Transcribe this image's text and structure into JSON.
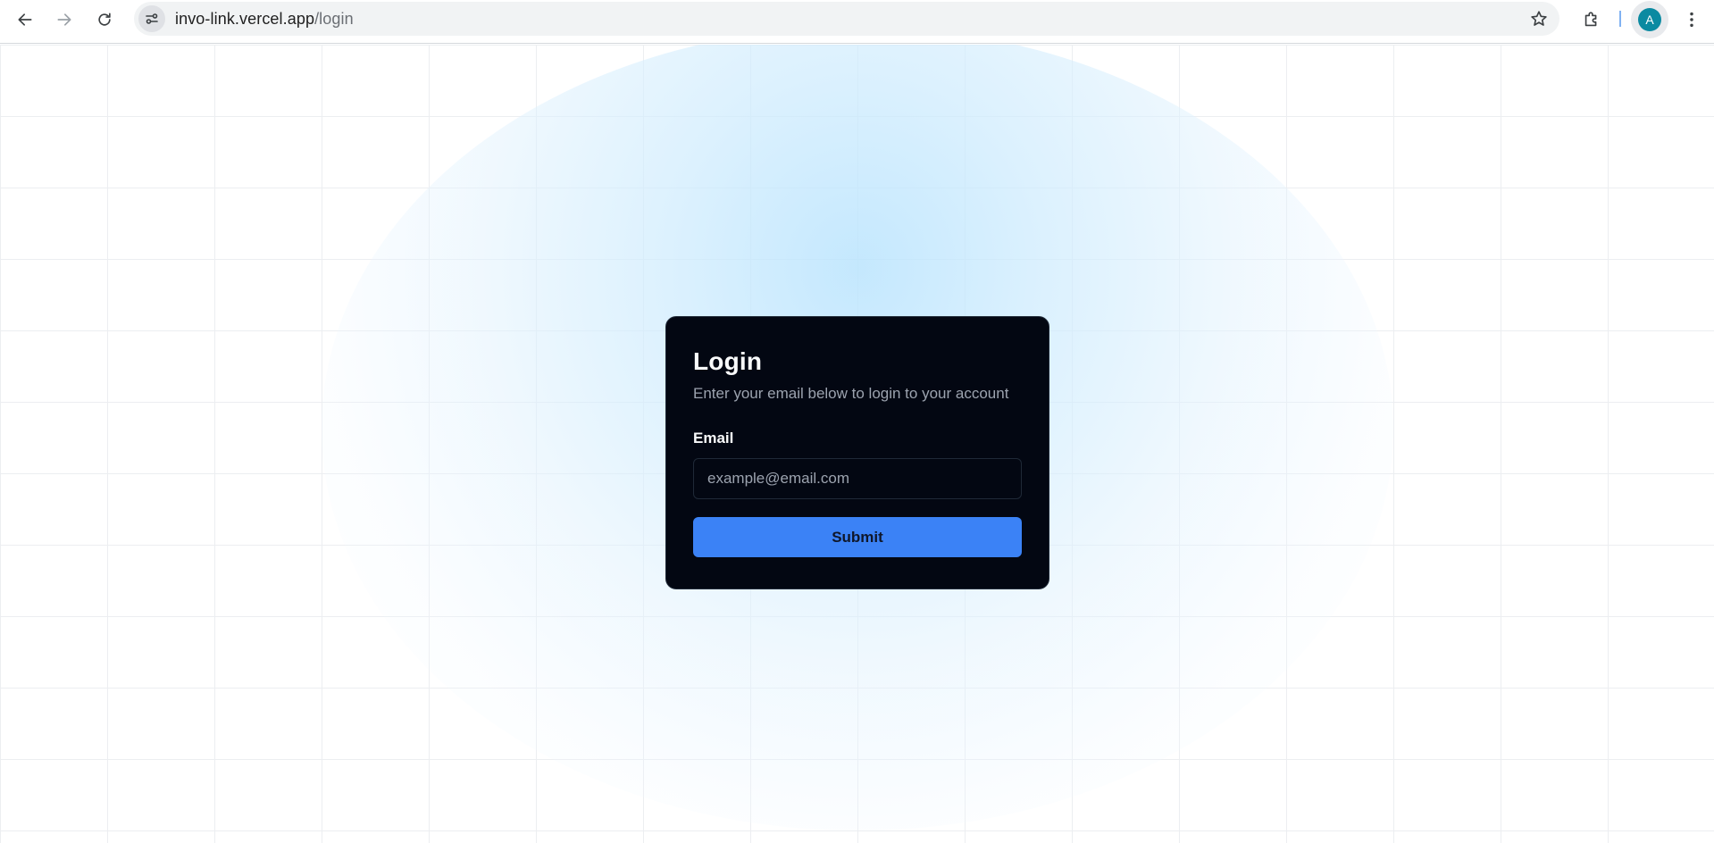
{
  "browser": {
    "url_host": "invo-link.vercel.app",
    "url_path": "/login",
    "profile_initial": "A",
    "icons": {
      "back": "back-arrow-icon",
      "forward": "forward-arrow-icon",
      "reload": "reload-icon",
      "site_info": "tune-icon",
      "bookmark": "star-icon",
      "extensions": "puzzle-icon",
      "menu": "kebab-menu-icon"
    },
    "colors": {
      "avatar": "#0b8aa1"
    }
  },
  "login": {
    "title": "Login",
    "description": "Enter your email below to login to your account",
    "email_label": "Email",
    "email_placeholder": "example@email.com",
    "email_value": "",
    "submit_label": "Submit"
  },
  "colors": {
    "card_bg": "#030712",
    "primary": "#3b82f6",
    "glow": "#bae4fd"
  }
}
